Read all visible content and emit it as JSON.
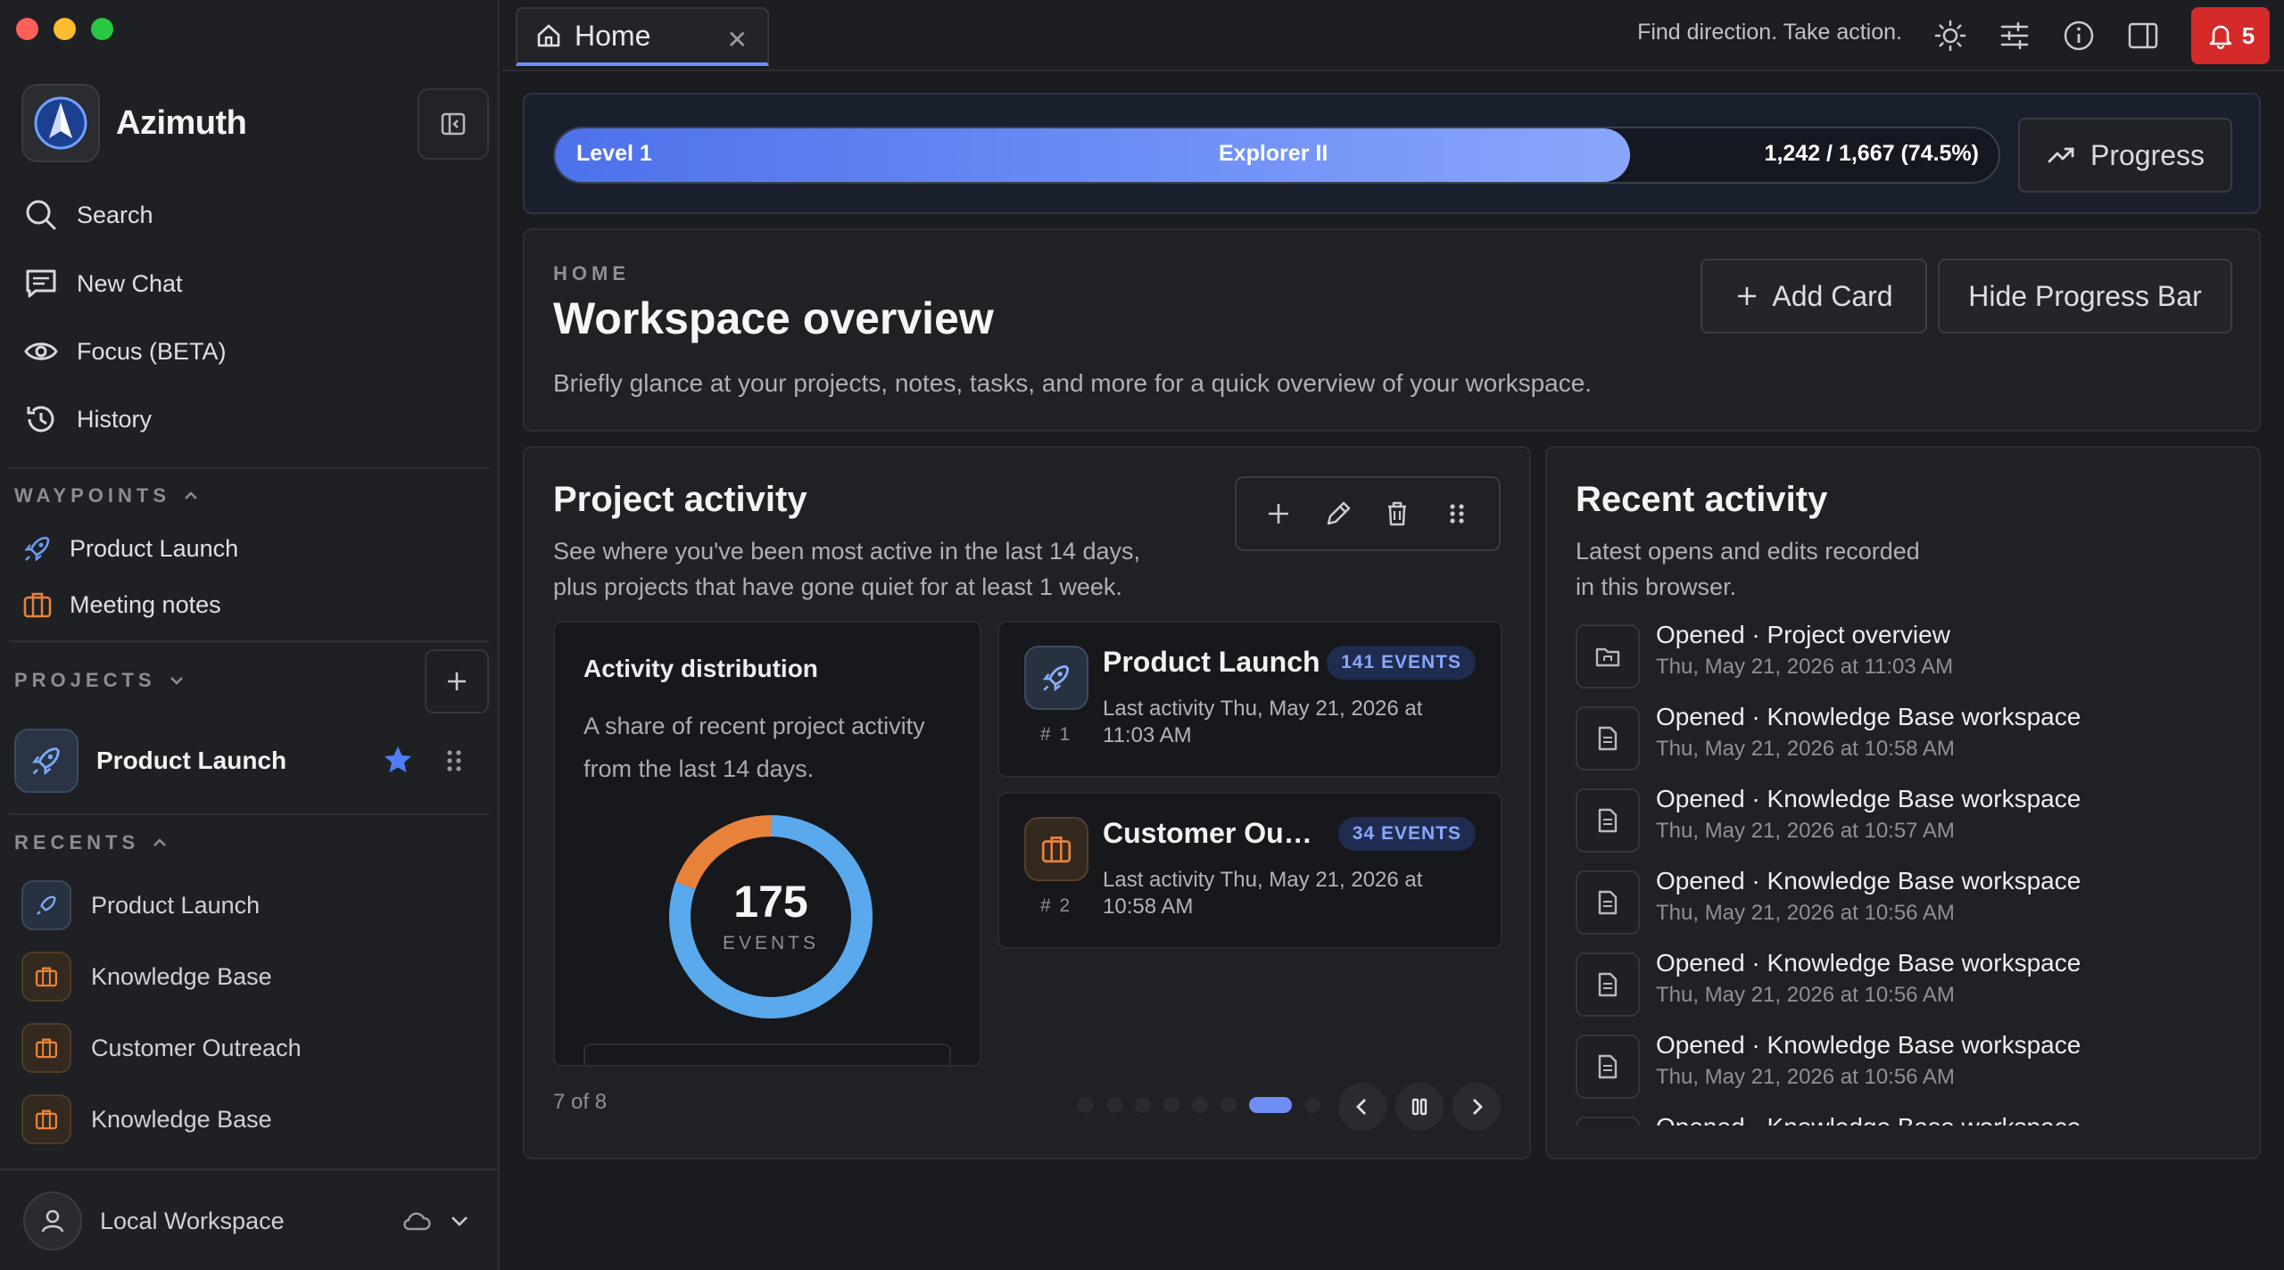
{
  "window": {
    "traffic_lights": [
      "#ff5f57",
      "#febc2e",
      "#28c840"
    ]
  },
  "sidebar": {
    "brand": "Azimuth",
    "nav": [
      {
        "label": "Search",
        "icon": "search-icon"
      },
      {
        "label": "New Chat",
        "icon": "chat-icon"
      },
      {
        "label": "Focus (BETA)",
        "icon": "eye-icon"
      },
      {
        "label": "History",
        "icon": "history-icon"
      }
    ],
    "waypoints_label": "WAYPOINTS",
    "waypoints": [
      {
        "label": "Product Launch",
        "icon": "rocket-icon"
      },
      {
        "label": "Meeting notes",
        "icon": "briefcase-icon"
      }
    ],
    "projects_label": "PROJECTS",
    "projects": [
      {
        "label": "Product Launch",
        "starred": true
      }
    ],
    "recents_label": "RECENTS",
    "recents": [
      {
        "label": "Product Launch",
        "icon": "rocket-icon"
      },
      {
        "label": "Knowledge Base",
        "icon": "briefcase-icon"
      },
      {
        "label": "Customer Outreach",
        "icon": "briefcase-icon"
      },
      {
        "label": "Knowledge Base",
        "icon": "briefcase-icon"
      }
    ],
    "workspace": "Local Workspace"
  },
  "topbar": {
    "tab_title": "Home",
    "tagline": "Find direction. Take action.",
    "notification_count": "5"
  },
  "progress": {
    "level": "Level 1",
    "rank": "Explorer II",
    "stats": "1,242 / 1,667 (74.5%)",
    "fraction": 0.745,
    "button": "Progress"
  },
  "overview": {
    "eyebrow": "HOME",
    "title": "Workspace overview",
    "description": "Briefly glance at your projects, notes, tasks, and more for a quick overview of your workspace.",
    "add_card": "Add Card",
    "hide_progress": "Hide Progress Bar"
  },
  "project_activity": {
    "title": "Project activity",
    "description_line1": "See where you've been most active in the last 14 days,",
    "description_line2": "plus projects that have gone quiet for at least 1 week.",
    "distribution": {
      "title": "Activity distribution",
      "description": "A share of recent project activity from the last 14 days.",
      "total": "175",
      "total_label": "EVENTS",
      "segments": [
        {
          "name": "Product Launch",
          "value": 141,
          "color": "#5aa9ec"
        },
        {
          "name": "Customer Outreach",
          "value": 34,
          "color": "#e8823a"
        }
      ]
    },
    "projects": [
      {
        "rank": "# 1",
        "name": "Product Launch",
        "badge": "141 EVENTS",
        "last": "Last activity Thu, May 21, 2026 at 11:03 AM",
        "icon": "rocket-icon"
      },
      {
        "rank": "# 2",
        "name": "Customer Outreach",
        "badge": "34 EVENTS",
        "last": "Last activity Thu, May 21, 2026 at 10:58 AM",
        "icon": "briefcase-icon"
      }
    ],
    "pager": "7 of 8",
    "page_count": 8,
    "active_page": 7
  },
  "recent_activity": {
    "title": "Recent activity",
    "description_line1": "Latest opens and edits recorded",
    "description_line2": "in this browser.",
    "items": [
      {
        "title": "Opened · Project overview",
        "time": "Thu, May 21, 2026 at 11:03 AM",
        "icon": "folder-icon"
      },
      {
        "title": "Opened · Knowledge Base workspace",
        "time": "Thu, May 21, 2026 at 10:58 AM",
        "icon": "document-icon"
      },
      {
        "title": "Opened · Knowledge Base workspace",
        "time": "Thu, May 21, 2026 at 10:57 AM",
        "icon": "document-icon"
      },
      {
        "title": "Opened · Knowledge Base workspace",
        "time": "Thu, May 21, 2026 at 10:56 AM",
        "icon": "document-icon"
      },
      {
        "title": "Opened · Knowledge Base workspace",
        "time": "Thu, May 21, 2026 at 10:56 AM",
        "icon": "document-icon"
      },
      {
        "title": "Opened · Knowledge Base workspace",
        "time": "Thu, May 21, 2026 at 10:56 AM",
        "icon": "document-icon"
      },
      {
        "title": "Opened · Knowledge Base workspace",
        "time": "",
        "icon": "document-icon"
      }
    ]
  },
  "colors": {
    "accent": "#6f8ef5",
    "notification": "#d42a2a",
    "star": "#4f7df5",
    "orange": "#e8823a"
  }
}
